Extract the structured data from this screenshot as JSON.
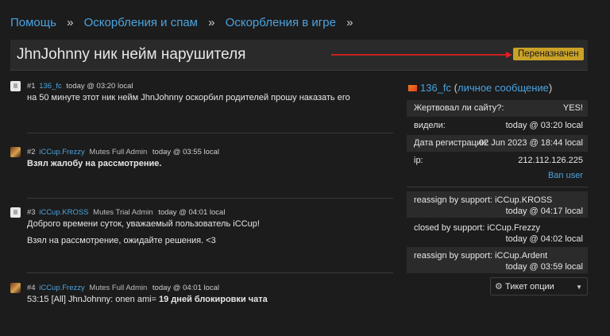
{
  "breadcrumb": [
    "Помощь",
    "Оскорбления и спам",
    "Оскорбления в игре"
  ],
  "breadcrumb_sep": "»",
  "ticket": {
    "title": "JhnJohnny ник нейм нарушителя",
    "status": "Переназначен",
    "status_color": "#c9a227",
    "arrow_color": "#e02020"
  },
  "posts": [
    {
      "num": "#1",
      "user": "136_fc",
      "role": "",
      "time": "today @ 03:20 local",
      "lines": [
        "на 50 минуте этот ник нейм JhnJohnny оскорбил родителей прошу наказать его"
      ]
    },
    {
      "num": "#2",
      "user": "iCCup.Frezzy",
      "role": "Mutes Full Admin",
      "time": "today @ 03:55 local",
      "lines": [
        "Взял жалобу на рассмотрение."
      ]
    },
    {
      "num": "#3",
      "user": "iCCup.KROSS",
      "role": "Mutes Trial Admin",
      "time": "today @ 04:01 local",
      "lines": [
        "Доброго времени суток, уважаемый пользователь iCCup!",
        "Взял на рассмотрение, ожидайте решения. <3"
      ]
    },
    {
      "num": "#4",
      "user": "iCCup.Frezzy",
      "role": "Mutes Full Admin",
      "time": "today @ 04:01 local",
      "line_prefix": "53:15 [All] JhnJohnny: onen ami= ",
      "line_bold": "19 дней блокировки чата"
    }
  ],
  "sidebar": {
    "user": "136_fc",
    "pm_link": "личное сообщение",
    "info": [
      {
        "k": "Жертвовал ли сайту?:",
        "v": "YES!"
      },
      {
        "k": "видели:",
        "v": "today @ 03:20 local"
      },
      {
        "k": "Дата регистрации:",
        "v": "02 Jun 2023 @ 18:44 local"
      },
      {
        "k": "ip:",
        "v": "212.112.126.225"
      }
    ],
    "ban_user": "Ban user",
    "log": [
      {
        "text": "reassign by support: iCCup.KROSS",
        "time": "today @ 04:17 local"
      },
      {
        "text": "closed by support: iCCup.Frezzy",
        "time": "today @ 04:02 local"
      },
      {
        "text": "reassign by support: iCCup.Ardent",
        "time": "today @ 03:59 local"
      }
    ],
    "options_label": "Тикет опции"
  }
}
